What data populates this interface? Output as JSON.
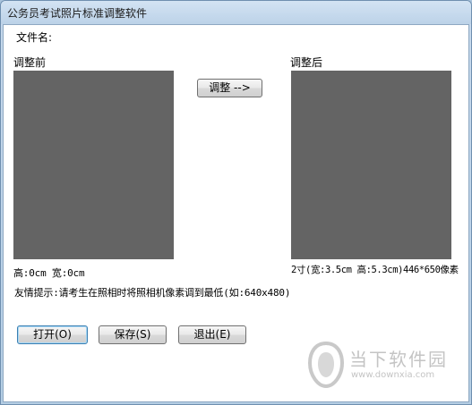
{
  "window": {
    "title": "公务员考试照片标准调整软件"
  },
  "file": {
    "label": "文件名:"
  },
  "before": {
    "label": "调整前",
    "size_text": "高:0cm  宽:0cm"
  },
  "after": {
    "label": "调整后",
    "size_text": "2寸(宽:3.5cm 高:5.3cm)446*650像素"
  },
  "adjust_button": "调整 -->",
  "tip": "友情提示:请考生在照相时将照相机像素调到最低(如:640x480)",
  "buttons": {
    "open": "打开(O)",
    "save": "保存(S)",
    "exit": "退出(E)"
  },
  "watermark": {
    "text": "当下软件园",
    "url": "www.downxia.com"
  },
  "colors": {
    "preview": "#646464",
    "titlebar": "#c6d9ec",
    "background": "#ffffff"
  }
}
